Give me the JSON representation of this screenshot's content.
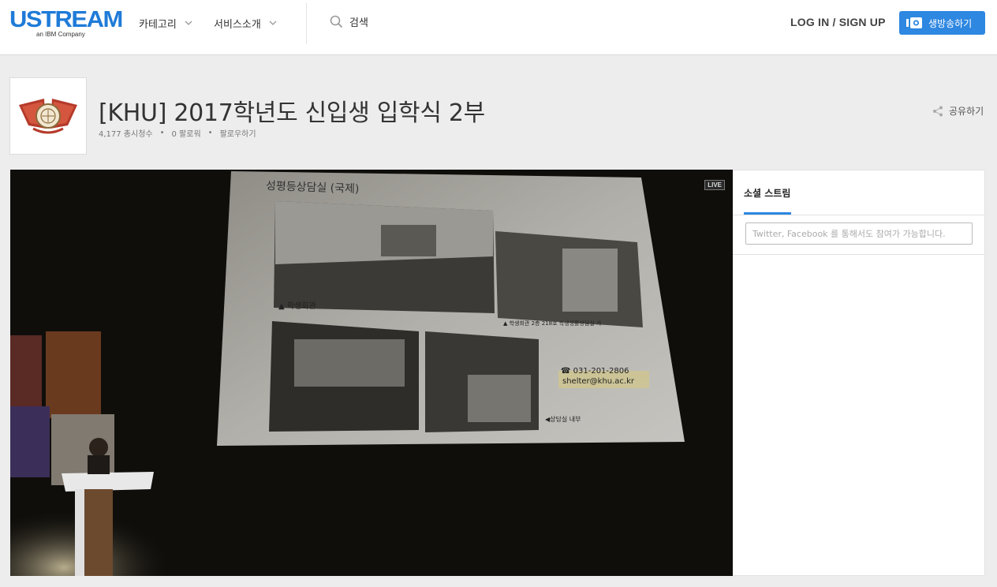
{
  "header": {
    "logo_text": "USTREAM",
    "logo_subtext": "an IBM Company",
    "nav": [
      {
        "label": "카테고리"
      },
      {
        "label": "서비스소개"
      }
    ],
    "search_label": "검색",
    "login_label": "LOG IN / SIGN UP",
    "broadcast_label": "생방송하기",
    "accent_color": "#2e87e0"
  },
  "channel": {
    "title": "[KHU] 2017학년도 신입생 입학식 2부",
    "views": "4,177 총시청수",
    "followers": "0 팔로워",
    "follow_label": "팔로우하기",
    "share_label": "공유하기"
  },
  "player": {
    "live_badge": "LIVE",
    "slide": {
      "heading": "성평등상담실 (국제)",
      "caption_building": "▲ 학생회관",
      "caption_room": "▲ 학생회관 2층 218호 학생생활상담실 가",
      "phone": "☎ 031-201-2806",
      "email": "shelter@khu.ac.kr",
      "caption_inside": "◀상담실 내부"
    }
  },
  "social": {
    "tab_label": "소셜 스트림",
    "input_placeholder": "Twitter, Facebook 를 통해서도 참여가 가능합니다."
  }
}
